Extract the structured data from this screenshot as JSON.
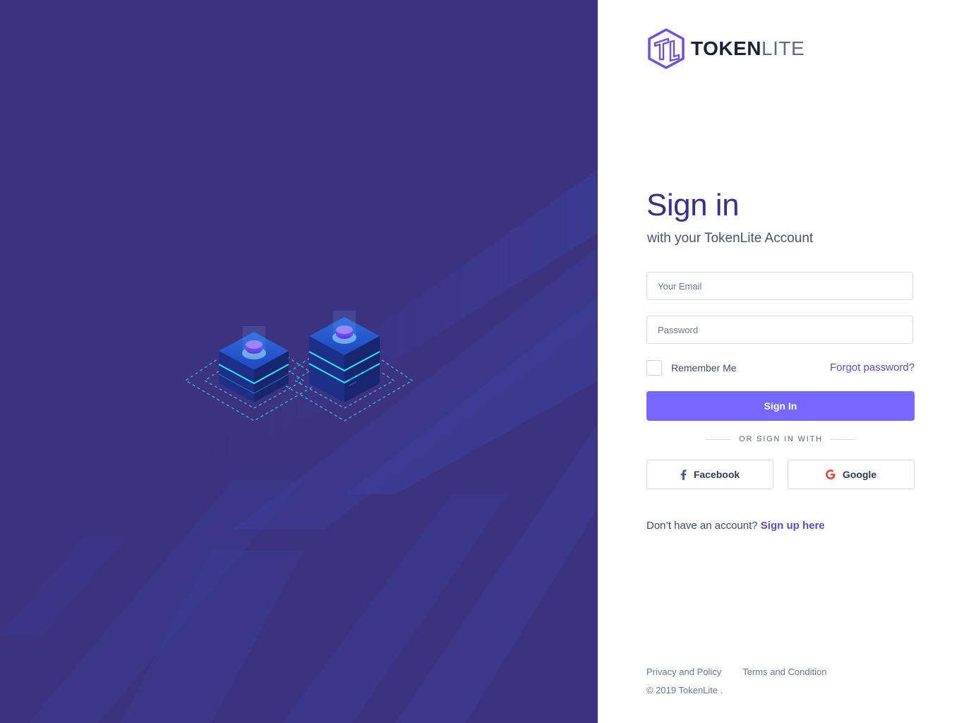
{
  "brand": {
    "name_bold": "TOKEN",
    "name_light": "LITE",
    "color_primary": "#7668fe",
    "color_panel": "#3c327f"
  },
  "signin": {
    "title": "Sign in",
    "subtitle": "with your TokenLite Account",
    "email_placeholder": "Your Email",
    "email_value": "",
    "password_placeholder": "Password",
    "password_value": "",
    "remember_label": "Remember Me",
    "remember_checked": false,
    "forgot_label": "Forgot password?",
    "submit_label": "Sign In"
  },
  "social": {
    "divider_label": "OR SIGN IN WITH",
    "facebook_label": "Facebook",
    "facebook_icon": "facebook-icon",
    "google_label": "Google",
    "google_icon": "google-icon"
  },
  "signup": {
    "prompt": "Don’t have an account?",
    "link_label": "Sign up here"
  },
  "footer": {
    "privacy_label": "Privacy and Policy",
    "terms_label": "Terms and Condition",
    "copyright": "© 2019 TokenLite ."
  }
}
